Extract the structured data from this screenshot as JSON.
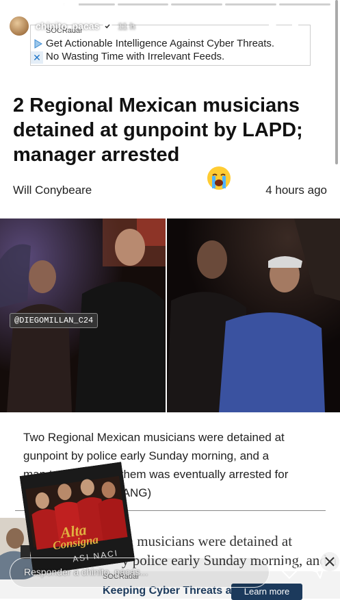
{
  "story": {
    "progress_segments": [
      1,
      0.3,
      0,
      0,
      0,
      0
    ],
    "username": "chinito_pacas",
    "time": "11 h",
    "reply_placeholder": "Responder a chinito_pacas..."
  },
  "ad_top": {
    "brand": "SOCRadar",
    "line1": "Get Actionable Intelligence Against Cyber Threats.",
    "line2": "No Wasting Time with Irrelevant Feeds."
  },
  "article": {
    "headline": "2 Regional Mexican musicians detained at gunpoint by LAPD; manager arrested",
    "author": "Will Conybeare",
    "ago": "4 hours ago",
    "photo_watermark": "@DIEGOMILLAN_C24",
    "para_line1": "Two Regional Mexican musicians were detained at",
    "para_line2": "gunpoint by police early Sunday morning, and a",
    "para_line3": "man traveling with them was eventually arrested for",
    "para_line4_fragment": "(ANG)",
    "serif_line1": "ican musicians were detained at",
    "serif_line2": "y police early Sunday morning, and a"
  },
  "album_sticker": {
    "title_line1": "Alta",
    "title_line2": "Consigna",
    "song": "ASI NACI"
  },
  "bottom_ad": {
    "brand": "SOCRadar",
    "text": "Keeping Cyber Threats at",
    "button": "Learn more"
  },
  "colors": {
    "ad_navy": "#1c3a5c",
    "story_white": "#ffffff"
  }
}
